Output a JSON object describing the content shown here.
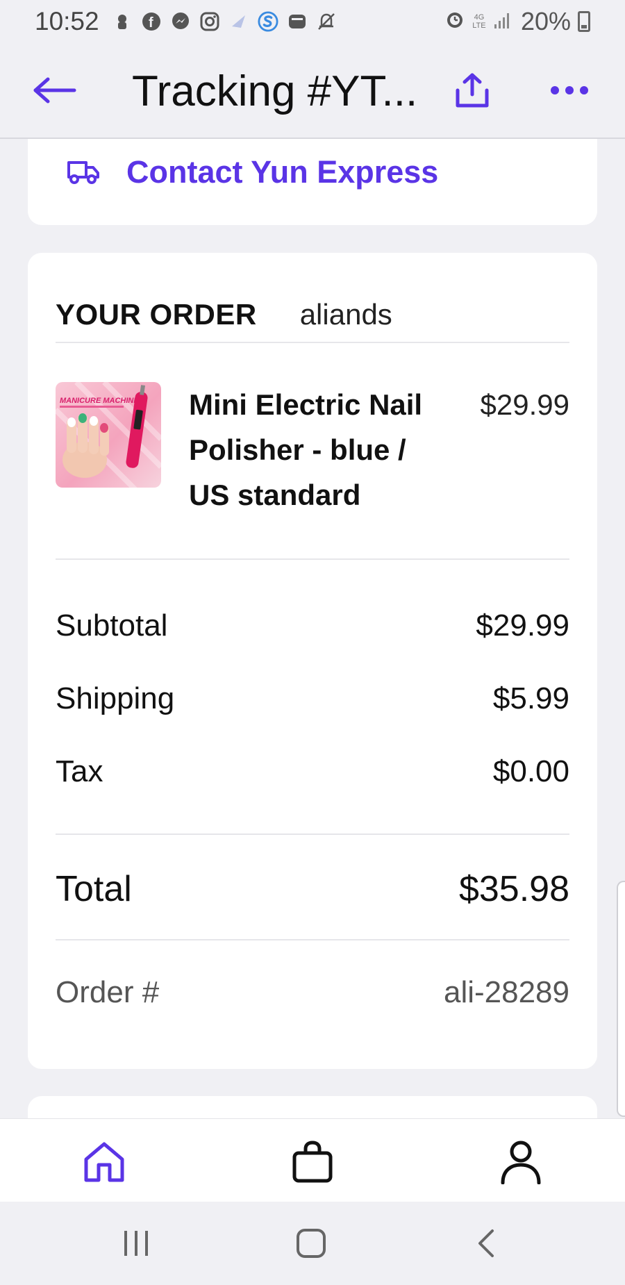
{
  "status_bar": {
    "time": "10:52",
    "battery": "20%",
    "network": "4G LTE"
  },
  "header": {
    "title": "Tracking #YT..."
  },
  "contact": {
    "label": "Contact Yun Express"
  },
  "order": {
    "heading": "YOUR ORDER",
    "store": "aliands",
    "product": {
      "name": "Mini Electric Nail Polisher - blue / US standard",
      "price": "$29.99",
      "image_text": "MANICURE MACHINE"
    },
    "summary": {
      "subtotal_label": "Subtotal",
      "subtotal_value": "$29.99",
      "shipping_label": "Shipping",
      "shipping_value": "$5.99",
      "tax_label": "Tax",
      "tax_value": "$0.00"
    },
    "total_label": "Total",
    "total_value": "$35.98",
    "order_number_label": "Order #",
    "order_number_value": "ali-28289"
  },
  "bottom_nav": [
    "home-icon",
    "shopping-bag-icon",
    "profile-icon"
  ],
  "colors": {
    "accent": "#5a34e6",
    "background": "#f0f0f4"
  }
}
